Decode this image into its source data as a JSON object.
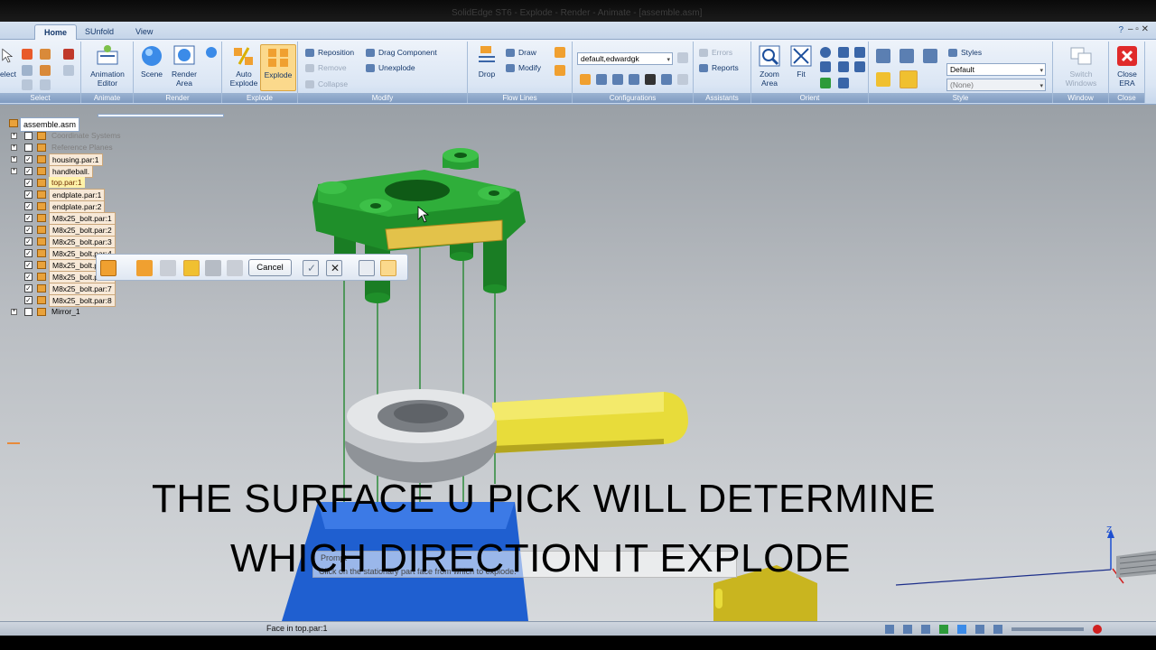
{
  "window": {
    "title": "SolidEdge ST6 - Explode - Render - Animate - [assemble.asm]"
  },
  "tabs": [
    {
      "label": "Home",
      "active": true
    },
    {
      "label": "SUnfold",
      "active": false
    },
    {
      "label": "View",
      "active": false
    }
  ],
  "ribbon": {
    "select": {
      "label": "Select",
      "tool_label": "elect"
    },
    "animate": {
      "label": "Animate",
      "animation_editor": "Animation Editor"
    },
    "render": {
      "label": "Render",
      "scene": "Scene",
      "render_area": "Render Area"
    },
    "explode": {
      "label": "Explode",
      "auto_explode": "Auto Explode",
      "explode": "Explode"
    },
    "modify": {
      "label": "Modify",
      "reposition": "Reposition",
      "remove": "Remove",
      "collapse": "Collapse",
      "drag_component": "Drag Component",
      "unexplode": "Unexplode"
    },
    "flowlines": {
      "label": "Flow Lines",
      "drop": "Drop",
      "draw": "Draw",
      "modify": "Modify"
    },
    "configurations": {
      "label": "Configurations",
      "combo_value": "default,edwardgk"
    },
    "assistants": {
      "label": "Assistants",
      "errors": "Errors",
      "reports": "Reports"
    },
    "orient": {
      "label": "Orient",
      "zoom_area": "Zoom Area",
      "fit": "Fit"
    },
    "style": {
      "label": "Style",
      "styles": "Styles",
      "combo1": "Default",
      "combo2": "(None)"
    },
    "window": {
      "label": "Window",
      "switch_windows": "Switch Windows"
    },
    "close": {
      "label": "Close",
      "close_era": "Close ERA"
    }
  },
  "tree": {
    "root": "assemble.asm",
    "items": [
      {
        "label": "Coordinate Systems",
        "style": "dim",
        "expand": true,
        "check": false,
        "icon": "coordinate-icon"
      },
      {
        "label": "Reference Planes",
        "style": "dim",
        "expand": true,
        "check": false,
        "icon": "plane-icon"
      },
      {
        "label": "housing.par:1",
        "style": "sel",
        "expand": true,
        "check": true,
        "icon": "part-icon"
      },
      {
        "label": "handleball.",
        "style": "sel",
        "expand": true,
        "check": true,
        "icon": "part-icon"
      },
      {
        "label": "top.par:1",
        "style": "hl",
        "expand": false,
        "check": true,
        "icon": "part-icon"
      },
      {
        "label": "endplate.par:1",
        "style": "sel",
        "expand": false,
        "check": true,
        "icon": "part-icon"
      },
      {
        "label": "endplate.par:2",
        "style": "sel",
        "expand": false,
        "check": true,
        "icon": "part-icon"
      },
      {
        "label": "M8x25_bolt.par:1",
        "style": "sel",
        "expand": false,
        "check": true,
        "icon": "part-icon"
      },
      {
        "label": "M8x25_bolt.par:2",
        "style": "sel",
        "expand": false,
        "check": true,
        "icon": "part-icon"
      },
      {
        "label": "M8x25_bolt.par:3",
        "style": "sel",
        "expand": false,
        "check": true,
        "icon": "part-icon"
      },
      {
        "label": "M8x25_bolt.par:4",
        "style": "sel",
        "expand": false,
        "check": true,
        "icon": "part-icon"
      },
      {
        "label": "M8x25_bolt.par:5",
        "style": "sel",
        "expand": false,
        "check": true,
        "icon": "part-icon"
      },
      {
        "label": "M8x25_bolt.par:6",
        "style": "sel",
        "expand": false,
        "check": true,
        "icon": "part-icon"
      },
      {
        "label": "M8x25_bolt.par:7",
        "style": "sel",
        "expand": false,
        "check": true,
        "icon": "part-icon"
      },
      {
        "label": "M8x25_bolt.par:8",
        "style": "sel",
        "expand": false,
        "check": true,
        "icon": "part-icon"
      },
      {
        "label": "Mirror_1",
        "style": "plain",
        "expand": true,
        "check": false,
        "icon": "mirror-icon"
      }
    ]
  },
  "command_bar": {
    "cancel": "Cancel"
  },
  "caption": {
    "line1": "THE SURFACE U  PICK WILL DETERMINE",
    "line2": "WHICH DIRECTION IT EXPLODE"
  },
  "prompt": {
    "label": "Prompt",
    "text": "Click on the stationary part face from which to explode."
  },
  "axis": {
    "z_label": "Z"
  },
  "status": {
    "text": "Face in top.par:1"
  },
  "colors": {
    "green_part": "#1f8f2a",
    "selected_face": "#e3c24a",
    "blue_part": "#1f5fd0",
    "yellow_handle": "#e8dc3a"
  }
}
